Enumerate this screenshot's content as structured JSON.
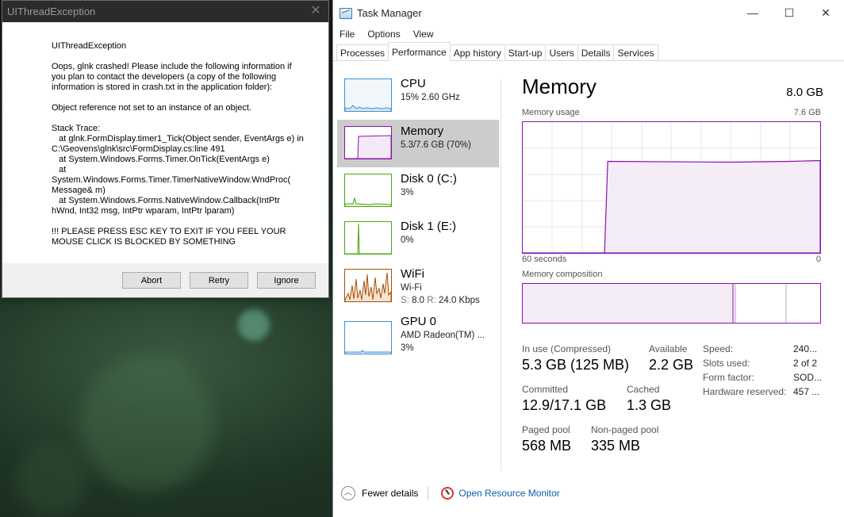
{
  "dialog": {
    "title": "UIThreadException",
    "heading": "UIThreadException",
    "message": "Oops, glnk crashed! Please include the following information if you plan to contact the developers (a copy of the following information is stored in crash.txt in the application folder):",
    "error": "Object reference not set to an instance of an object.",
    "stack_trace": "Stack Trace:\n   at glnk.FormDisplay.timer1_Tick(Object sender, EventArgs e) in C:\\Geovens\\glnk\\src\\FormDisplay.cs:line 491\n   at System.Windows.Forms.Timer.OnTick(EventArgs e)\n   at\nSystem.Windows.Forms.Timer.TimerNativeWindow.WndProc(\nMessage& m)\n   at System.Windows.Forms.NativeWindow.Callback(IntPtr\nhWnd, Int32 msg, IntPtr wparam, IntPtr lparam)",
    "warning": "!!! PLEASE PRESS ESC KEY TO EXIT IF YOU FEEL YOUR MOUSE CLICK IS BLOCKED BY SOMETHING",
    "buttons": {
      "abort": "Abort",
      "retry": "Retry",
      "ignore": "Ignore"
    }
  },
  "taskmanager": {
    "title": "Task Manager",
    "window_controls": {
      "minimize": "—",
      "maximize": "☐",
      "close": "✕"
    },
    "menu": [
      "File",
      "Options",
      "View"
    ],
    "tabs": [
      "Processes",
      "Performance",
      "App history",
      "Start-up",
      "Users",
      "Details",
      "Services"
    ],
    "active_tab": "Performance",
    "resources": [
      {
        "name": "CPU",
        "line1": "15% 2.60 GHz",
        "line2": "",
        "color": "#3f8fd1"
      },
      {
        "name": "Memory",
        "line1": "5.3/7.6 GB (70%)",
        "line2": "",
        "color": "#8b12ae"
      },
      {
        "name": "Disk 0 (C:)",
        "line1": "3%",
        "line2": "",
        "color": "#4da60c"
      },
      {
        "name": "Disk 1 (E:)",
        "line1": "0%",
        "line2": "",
        "color": "#4da60c"
      },
      {
        "name": "WiFi",
        "line1": "Wi-Fi",
        "line2_s_label": "S:",
        "line2_s": "8.0",
        "line2_r_label": "R:",
        "line2_r": "24.0 Kbps",
        "color": "#a74f01"
      },
      {
        "name": "GPU 0",
        "line1": "AMD Radeon(TM) ...",
        "line2": "3%",
        "color": "#3f8fd1"
      }
    ],
    "memory": {
      "title": "Memory",
      "total": "8.0 GB",
      "usage_label": "Memory usage",
      "usage_max": "7.6 GB",
      "time_left": "60 seconds",
      "time_right": "0",
      "composition_label": "Memory composition",
      "usage_fraction_start": 0.0,
      "usage_fraction_end": 0.7,
      "stats": {
        "in_use_label": "In use (Compressed)",
        "in_use": "5.3 GB (125 MB)",
        "available_label": "Available",
        "available": "2.2 GB",
        "committed_label": "Committed",
        "committed": "12.9/17.1 GB",
        "cached_label": "Cached",
        "cached": "1.3 GB",
        "paged_label": "Paged pool",
        "paged": "568 MB",
        "nonpaged_label": "Non-paged pool",
        "nonpaged": "335 MB"
      },
      "details": {
        "speed_label": "Speed:",
        "speed": "240...",
        "slots_label": "Slots used:",
        "slots": "2 of 2",
        "form_label": "Form factor:",
        "form": "SOD...",
        "hw_label": "Hardware reserved:",
        "hw": "457 ..."
      }
    },
    "footer": {
      "fewer": "Fewer details",
      "resource_monitor": "Open Resource Monitor"
    }
  }
}
